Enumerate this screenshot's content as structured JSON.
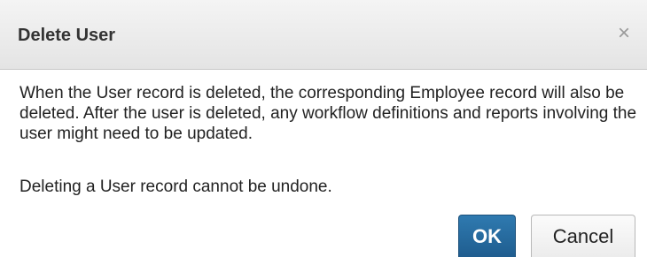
{
  "dialog": {
    "title": "Delete User",
    "close_glyph": "×",
    "message": "When the User record is deleted, the corresponding Employee record will also be deleted. After the user is deleted, any workflow definitions and reports involving the user might need to be updated.",
    "note": "Deleting a User record cannot be undone.",
    "ok_label": "OK",
    "cancel_label": "Cancel"
  },
  "colors": {
    "ok_button": "#1f5d8f",
    "titlebar": "#e9e9e9",
    "close_icon": "#9a9a9a"
  },
  "icons": {
    "close": "close-icon"
  }
}
